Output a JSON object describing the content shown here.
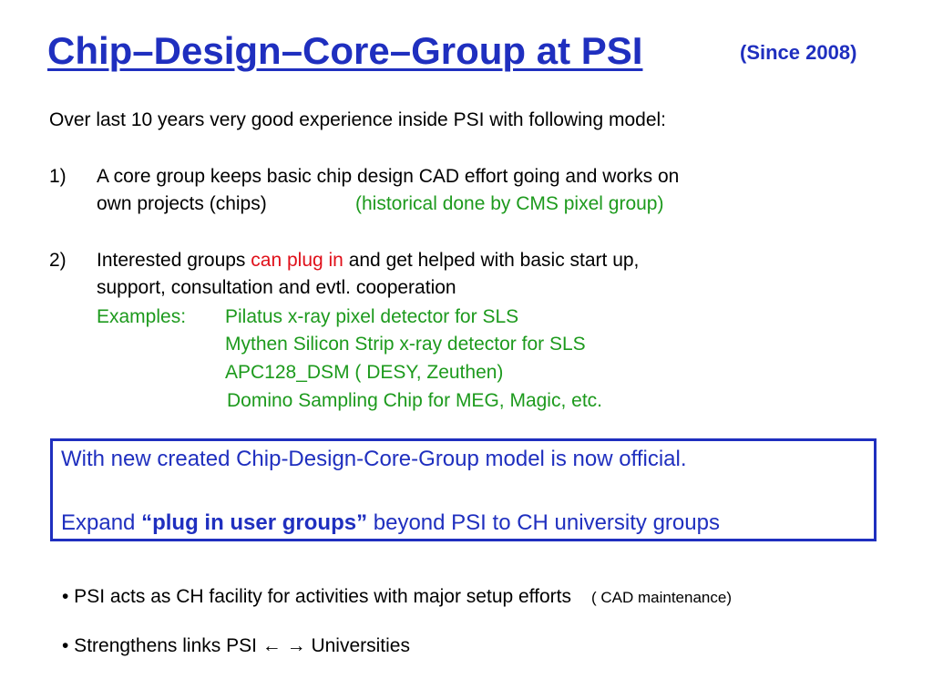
{
  "title": "Chip–Design–Core–Group at PSI",
  "since": "(Since 2008)",
  "intro": "Over last 10 years very good experience inside PSI with following model:",
  "item1": {
    "number": "1)",
    "line1": "A core group keeps basic chip design CAD effort going and works on",
    "line2": "own projects (chips)",
    "note": "(historical done by CMS pixel group)"
  },
  "item2": {
    "number": "2)",
    "line1_pre": "Interested groups ",
    "line1_highlight": "can plug in",
    "line1_post": " and get helped with basic start up,",
    "line2": "support, consultation and evtl. cooperation",
    "examples_label": "Examples:",
    "examples": [
      "Pilatus x-ray pixel detector  for SLS",
      "Mythen Silicon Strip  x-ray detector for SLS",
      "APC128_DSM  ( DESY, Zeuthen)",
      "Domino Sampling Chip for MEG, Magic, etc."
    ]
  },
  "box": {
    "line1": "With new created Chip-Design-Core-Group model is now official.",
    "line2_pre": "Expand  ",
    "line2_bold": "“plug in user groups”",
    "line2_post": " beyond PSI to CH university groups"
  },
  "bullets": [
    {
      "text": "• PSI acts as CH facility for activities with major setup efforts",
      "note": "( CAD maintenance)"
    },
    {
      "text": "• Strengthens links  PSI ← → Universities"
    }
  ],
  "colors": {
    "title": "#1f2fbf",
    "green": "#1d9a1d",
    "red": "#e0101a"
  }
}
